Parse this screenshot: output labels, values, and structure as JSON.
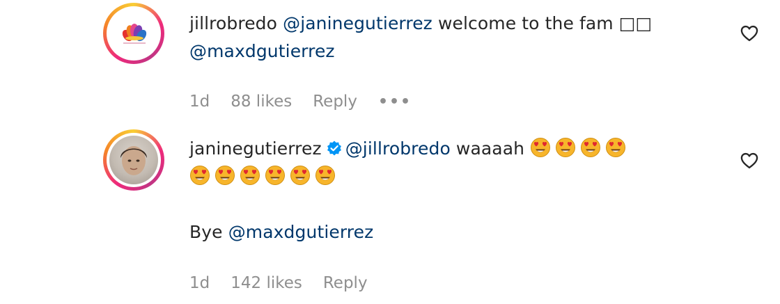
{
  "comments": [
    {
      "username": "jillrobredo",
      "mention1": "@janinegutierrez",
      "text1": " welcome to the fam □□",
      "mention2": "@maxdgutierrez",
      "time": "1d",
      "likes": "88 likes",
      "reply": "Reply",
      "more": "•••",
      "avatar": "flower-logo-icon"
    },
    {
      "username": "janinegutierrez",
      "verified": true,
      "mention1": "@jillrobredo",
      "text1": " waaaah ",
      "emojis_line1": 4,
      "emojis_line2": 6,
      "text2": "Bye ",
      "mention2": "@maxdgutierrez",
      "time": "1d",
      "likes": "142 likes",
      "reply": "Reply",
      "avatar": "profile-photo"
    }
  ],
  "colors": {
    "text": "#262626",
    "mention": "#00376b",
    "meta": "#8e8e8e",
    "verified": "#0095f6",
    "emoji_face": "#f7b52b"
  },
  "icons": {
    "like": "heart-icon",
    "verified": "verified-badge-icon",
    "emoji": "heart-eyes-emoji-icon"
  }
}
